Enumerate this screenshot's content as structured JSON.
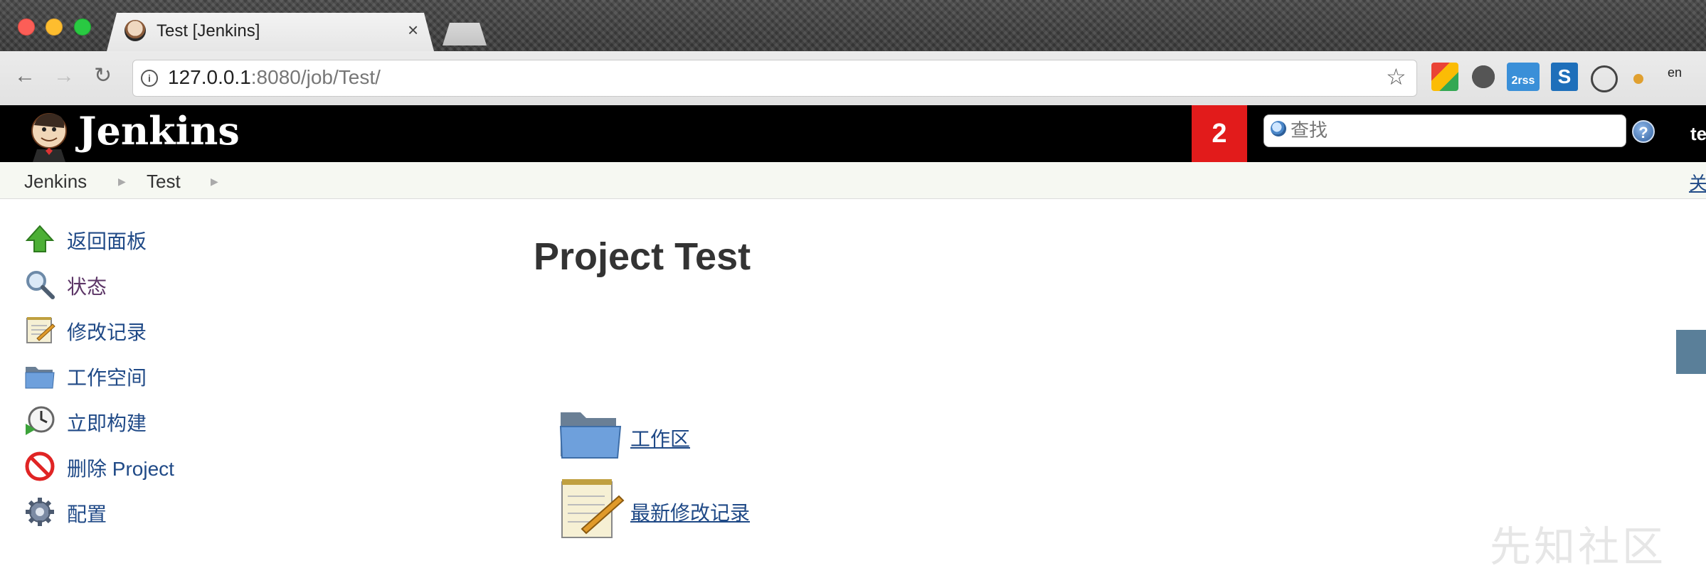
{
  "browser": {
    "tab_title": "Test [Jenkins]",
    "tab_close": "×",
    "url_host": "127.0.0.1",
    "url_rest": ":8080/job/Test/",
    "ext3_label": "2rss"
  },
  "header": {
    "app_title": "Jenkins",
    "notification_count": "2",
    "search_placeholder": "查找",
    "help": "?",
    "user": "te"
  },
  "breadcrumb": {
    "items": [
      "Jenkins",
      "Test"
    ],
    "right_link": "关"
  },
  "side_panel": {
    "tasks": [
      {
        "label": "返回面板",
        "icon": "up-arrow-icon"
      },
      {
        "label": "状态",
        "icon": "magnifier-icon"
      },
      {
        "label": "修改记录",
        "icon": "notepad-icon"
      },
      {
        "label": "工作空间",
        "icon": "folder-icon"
      },
      {
        "label": "立即构建",
        "icon": "clock-build-icon"
      },
      {
        "label": "删除 Project",
        "icon": "no-entry-icon"
      },
      {
        "label": "配置",
        "icon": "gear-icon"
      }
    ]
  },
  "main": {
    "title": "Project Test",
    "links": [
      {
        "label": "工作区",
        "icon": "folder-icon"
      },
      {
        "label": "最新修改记录",
        "icon": "notepad-icon"
      }
    ]
  },
  "watermark": "先知社区"
}
